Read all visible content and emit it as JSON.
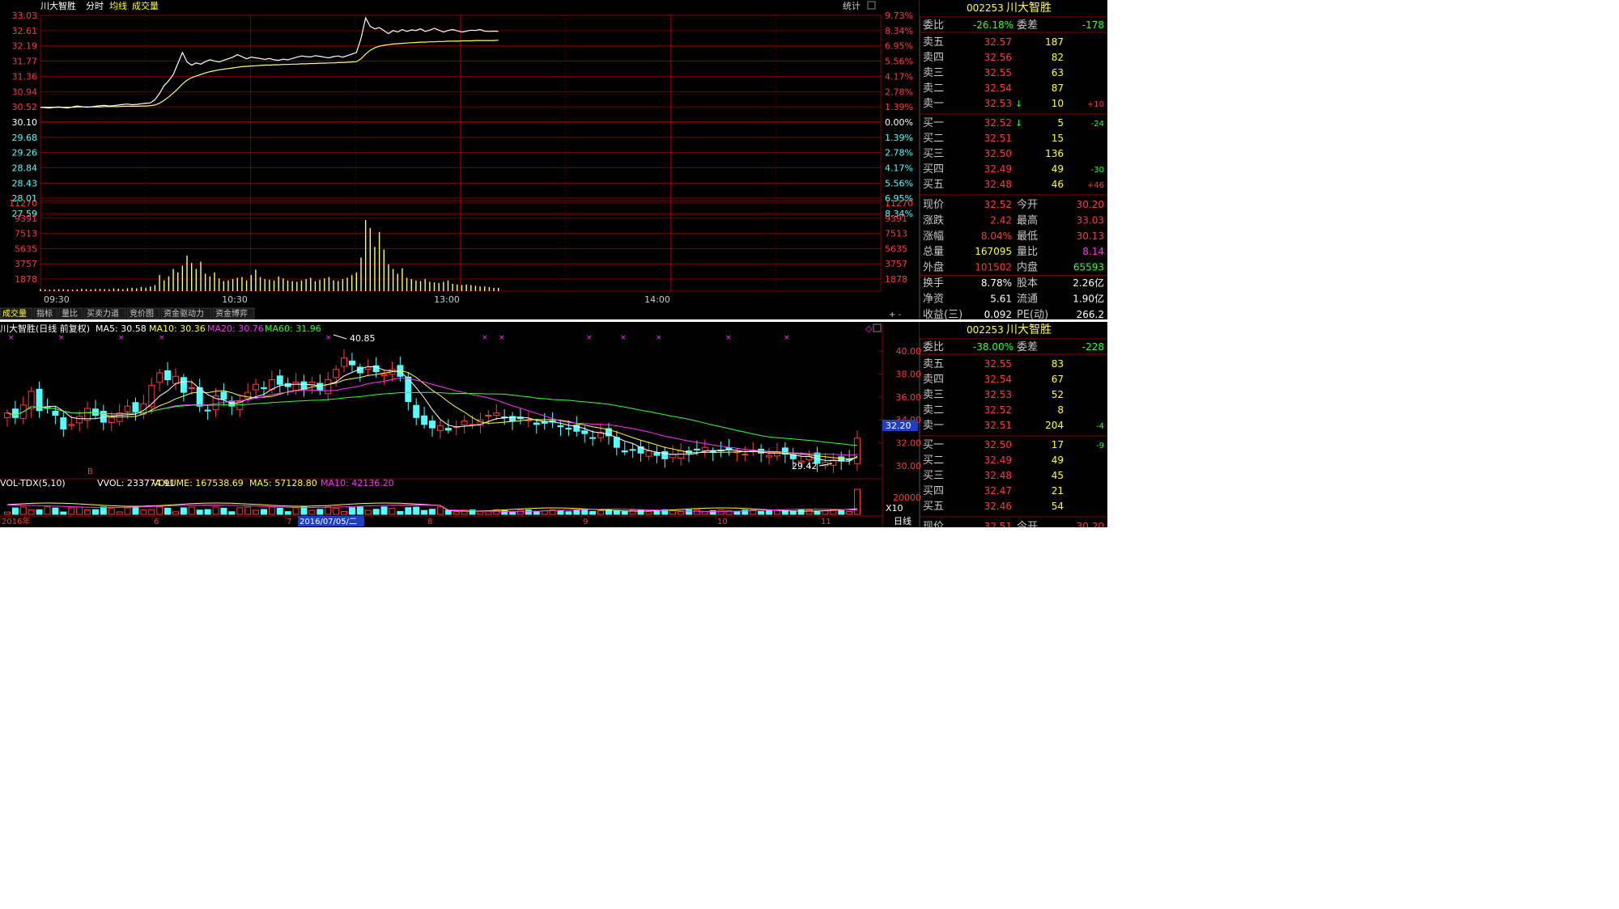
{
  "intraday": {
    "title": "川大智胜",
    "labels": [
      "分时",
      "均线",
      "成交量"
    ],
    "stats_label": "统计",
    "price_ticks": [
      "33.03",
      "32.61",
      "32.19",
      "31.77",
      "31.36",
      "30.94",
      "30.52",
      "30.10",
      "29.68",
      "29.26",
      "28.84",
      "28.43",
      "28.01",
      "27.59"
    ],
    "pct_ticks": [
      "9.73%",
      "8.34%",
      "6.95%",
      "5.56%",
      "4.17%",
      "2.78%",
      "1.39%",
      "0.00%",
      "1.39%",
      "2.78%",
      "4.17%",
      "5.56%",
      "6.95%",
      "8.34%"
    ],
    "vol_ticks": [
      "11270",
      "9391",
      "7513",
      "5635",
      "3757",
      "1878"
    ],
    "time_ticks": [
      "09:30",
      "10:30",
      "13:00",
      "14:00"
    ],
    "tabs": [
      "成交量",
      "指标",
      "量比",
      "买卖力道",
      "竞价图",
      "资金驱动力",
      "资金博弈"
    ],
    "price_series": [
      30.11,
      30.1,
      30.09,
      30.11,
      30.12,
      30.1,
      30.09,
      30.12,
      30.15,
      30.13,
      30.11,
      30.12,
      30.14,
      30.16,
      30.17,
      30.15,
      30.16,
      30.18,
      30.2,
      30.21,
      30.19,
      30.2,
      30.22,
      30.24,
      30.25,
      30.35,
      30.55,
      30.8,
      30.95,
      31.15,
      31.5,
      31.85,
      31.55,
      31.45,
      31.52,
      31.48,
      31.56,
      31.62,
      31.58,
      31.55,
      31.6,
      31.65,
      31.7,
      31.78,
      31.72,
      31.65,
      31.7,
      31.68,
      31.66,
      31.63,
      31.66,
      31.62,
      31.6,
      31.64,
      31.62,
      31.66,
      31.7,
      31.74,
      31.72,
      31.71,
      31.75,
      31.73,
      31.7,
      31.68,
      31.72,
      31.74,
      31.7,
      31.75,
      31.8,
      31.85,
      32.3,
      32.95,
      32.68,
      32.6,
      32.64,
      32.55,
      32.45,
      32.55,
      32.5,
      32.58,
      32.52,
      32.57,
      32.55,
      32.6,
      32.52,
      32.56,
      32.62,
      32.56,
      32.5,
      32.55,
      32.58,
      32.54,
      32.5,
      32.53,
      32.56,
      32.55,
      32.58,
      32.53,
      32.52,
      32.53,
      32.52
    ],
    "avg_series": [
      30.11,
      30.11,
      30.11,
      30.11,
      30.11,
      30.11,
      30.11,
      30.11,
      30.12,
      30.12,
      30.12,
      30.12,
      30.12,
      30.12,
      30.13,
      30.13,
      30.13,
      30.13,
      30.14,
      30.14,
      30.14,
      30.14,
      30.15,
      30.15,
      30.16,
      30.18,
      30.24,
      30.33,
      30.44,
      30.56,
      30.7,
      30.85,
      30.97,
      31.05,
      31.1,
      31.15,
      31.2,
      31.24,
      31.27,
      31.3,
      31.32,
      31.34,
      31.36,
      31.38,
      31.4,
      31.41,
      31.42,
      31.43,
      31.44,
      31.45,
      31.45,
      31.46,
      31.46,
      31.47,
      31.47,
      31.48,
      31.48,
      31.49,
      31.49,
      31.5,
      31.5,
      31.51,
      31.51,
      31.52,
      31.52,
      31.53,
      31.53,
      31.54,
      31.55,
      31.56,
      31.65,
      31.8,
      31.92,
      32.0,
      32.05,
      32.08,
      32.1,
      32.12,
      32.13,
      32.14,
      32.15,
      32.16,
      32.17,
      32.18,
      32.18,
      32.19,
      32.19,
      32.2,
      32.2,
      32.21,
      32.21,
      32.21,
      32.22,
      32.22,
      32.22,
      32.23,
      32.23,
      32.23,
      32.23,
      32.23,
      32.24
    ],
    "volume_series": [
      300,
      260,
      220,
      250,
      300,
      280,
      250,
      230,
      280,
      350,
      300,
      260,
      320,
      340,
      300,
      280,
      420,
      360,
      300,
      450,
      500,
      420,
      600,
      520,
      700,
      900,
      2400,
      1600,
      2200,
      3300,
      2800,
      3800,
      5300,
      4200,
      3300,
      4400,
      2600,
      2200,
      2800,
      1900,
      1500,
      1600,
      1800,
      2000,
      2100,
      1600,
      2400,
      3200,
      2100,
      1800,
      1700,
      1600,
      2200,
      1900,
      1600,
      1500,
      1400,
      1600,
      1800,
      2000,
      1500,
      1700,
      1900,
      2100,
      1600,
      1500,
      1800,
      2000,
      2400,
      2800,
      5000,
      10600,
      9400,
      6600,
      8800,
      6200,
      4000,
      3300,
      2600,
      3400,
      2000,
      1800,
      1600,
      1500,
      1800,
      1400,
      1300,
      1200,
      1400,
      1600,
      1100,
      1000,
      900,
      1000,
      900,
      800,
      700,
      700,
      600,
      500,
      500
    ]
  },
  "quote_top": {
    "code": "002253",
    "name": "川大智胜",
    "weibi_label": "委比",
    "weibi_value": "-26.18%",
    "weicha_label": "委差",
    "weicha_value": "-178",
    "asks": [
      {
        "label": "卖五",
        "price": "32.57",
        "vol": "187",
        "chg": ""
      },
      {
        "label": "卖四",
        "price": "32.56",
        "vol": "82",
        "chg": ""
      },
      {
        "label": "卖三",
        "price": "32.55",
        "vol": "63",
        "chg": ""
      },
      {
        "label": "卖二",
        "price": "32.54",
        "vol": "87",
        "chg": ""
      },
      {
        "label": "卖一",
        "price": "32.53",
        "vol": "10",
        "chg": "+10"
      }
    ],
    "bids": [
      {
        "label": "买一",
        "price": "32.52",
        "vol": "5",
        "chg": "-24"
      },
      {
        "label": "买二",
        "price": "32.51",
        "vol": "15",
        "chg": ""
      },
      {
        "label": "买三",
        "price": "32.50",
        "vol": "136",
        "chg": ""
      },
      {
        "label": "买四",
        "price": "32.49",
        "vol": "49",
        "chg": "-30"
      },
      {
        "label": "买五",
        "price": "32.48",
        "vol": "46",
        "chg": "+46"
      }
    ],
    "stats": [
      {
        "l1": "现价",
        "v1": "32.52",
        "l2": "今开",
        "v2": "30.20"
      },
      {
        "l1": "涨跌",
        "v1": "2.42",
        "l2": "最高",
        "v2": "33.03"
      },
      {
        "l1": "涨幅",
        "v1": "8.04%",
        "l2": "最低",
        "v2": "30.13"
      },
      {
        "l1": "总量",
        "v1": "167095",
        "l2": "量比",
        "v2": "8.14"
      },
      {
        "l1": "外盘",
        "v1": "101502",
        "l2": "内盘",
        "v2": "65593"
      },
      {
        "l1": "换手",
        "v1": "8.78%",
        "l2": "股本",
        "v2": "2.26亿"
      },
      {
        "l1": "净资",
        "v1": "5.61",
        "l2": "流通",
        "v2": "1.90亿"
      },
      {
        "l1": "收益(三)",
        "v1": "0.092",
        "l2": "PE(动)",
        "v2": "266.2"
      }
    ]
  },
  "daily": {
    "title": "川大智胜(日线 前复权)",
    "ma5_text": "MA5: 30.58",
    "ma10_text": "MA10: 30.36",
    "ma20_text": "MA20: 30.76",
    "ma60_text": "MA60: 31.96",
    "y_ticks": [
      "40.00",
      "38.00",
      "36.00",
      "34.00",
      "32.00",
      "30.00"
    ],
    "current_price_tag": "32.20",
    "high_label": "40.85",
    "low_label": "29.42",
    "marker_b": "B",
    "vol_header": "VOL-TDX(5,10)",
    "vvol": "VVOL: 233774.91",
    "volume": "VOLUME: 167538.69",
    "vol_ma5": "MA5: 57128.80",
    "vol_ma10": "MA10: 42136.20",
    "vol_tick": "20000",
    "vol_unit": "X10",
    "date_labels": [
      "2016年",
      "6",
      "7",
      "2016/07/05/二",
      "8",
      "9",
      "10",
      "11"
    ],
    "period_label": "日线",
    "closes": [
      34.6,
      34.2,
      35.3,
      36.5,
      34.8,
      35.0,
      34.4,
      33.2,
      33.6,
      34.3,
      35.0,
      34.4,
      33.8,
      34.2,
      34.6,
      35.2,
      34.7,
      35.4,
      37.0,
      38.1,
      37.5,
      37.8,
      36.4,
      36.8,
      35.2,
      34.8,
      36.1,
      35.8,
      35.2,
      35.6,
      36.4,
      37.1,
      36.8,
      37.5,
      37.1,
      36.9,
      37.3,
      36.7,
      37.3,
      36.6,
      37.5,
      38.4,
      39.4,
      38.8,
      38.1,
      38.6,
      38.2,
      38.0,
      38.4,
      37.8,
      35.6,
      34.2,
      33.6,
      33.3,
      33.5,
      33.1,
      33.4,
      33.9,
      33.6,
      34.0,
      34.4,
      34.6,
      34.2,
      33.9,
      34.1,
      34.0,
      33.6,
      33.7,
      33.8,
      33.4,
      33.2,
      33.0,
      32.8,
      32.4,
      32.9,
      32.6,
      31.6,
      31.2,
      31.4,
      31.1,
      31.3,
      30.9,
      30.6,
      31.0,
      31.3,
      31.1,
      31.4,
      31.6,
      31.2,
      31.3,
      31.4,
      31.2,
      31.0,
      31.3,
      31.1,
      30.9,
      31.2,
      31.0,
      30.6,
      30.4,
      30.8,
      30.2,
      30.3,
      30.5,
      30.4,
      30.5,
      32.4
    ]
  },
  "quote_bottom": {
    "code": "002253",
    "name": "川大智胜",
    "weibi_label": "委比",
    "weibi_value": "-38.00%",
    "weicha_label": "委差",
    "weicha_value": "-228",
    "asks": [
      {
        "label": "卖五",
        "price": "32.55",
        "vol": "83",
        "chg": ""
      },
      {
        "label": "卖四",
        "price": "32.54",
        "vol": "67",
        "chg": ""
      },
      {
        "label": "卖三",
        "price": "32.53",
        "vol": "52",
        "chg": ""
      },
      {
        "label": "卖二",
        "price": "32.52",
        "vol": "8",
        "chg": ""
      },
      {
        "label": "卖一",
        "price": "32.51",
        "vol": "204",
        "chg": "-4"
      }
    ],
    "bids": [
      {
        "label": "买一",
        "price": "32.50",
        "vol": "17",
        "chg": "-9"
      },
      {
        "label": "买二",
        "price": "32.49",
        "vol": "49",
        "chg": ""
      },
      {
        "label": "买三",
        "price": "32.48",
        "vol": "45",
        "chg": ""
      },
      {
        "label": "买四",
        "price": "32.47",
        "vol": "21",
        "chg": ""
      },
      {
        "label": "买五",
        "price": "32.46",
        "vol": "54",
        "chg": ""
      }
    ],
    "stats": [
      {
        "l1": "现价",
        "v1": "32.51",
        "l2": "今开",
        "v2": "30.20"
      }
    ]
  },
  "colors": {
    "background": "#000000",
    "grid": "#8b0000",
    "up": "#ff3b3b",
    "down": "#54ffff",
    "price_line": "#ffffff",
    "avg_line": "#ffff66",
    "ma5": "#ffffff",
    "ma10": "#ffff33",
    "ma20": "#ff33ff",
    "ma60": "#33ff33",
    "header_text": "#ffff33"
  }
}
